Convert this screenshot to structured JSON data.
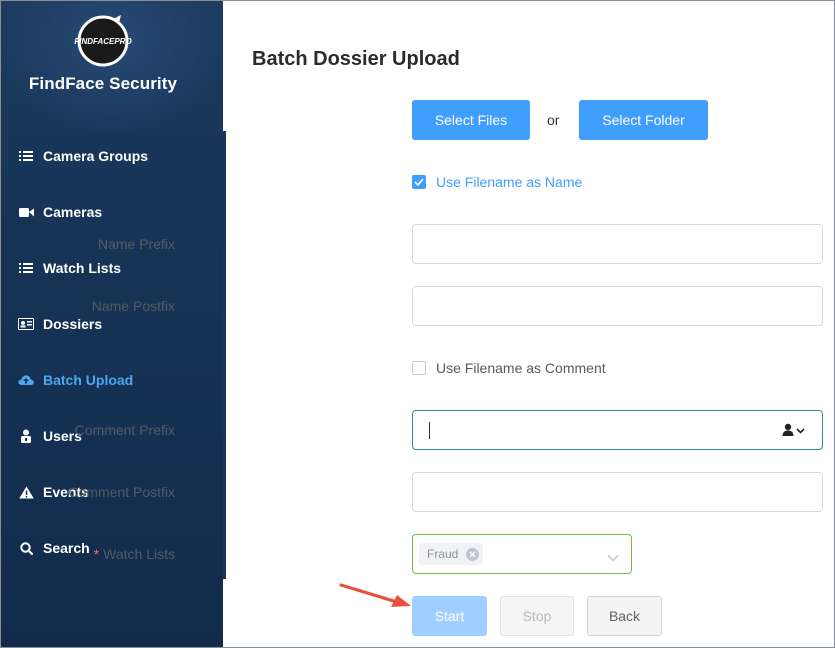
{
  "app": {
    "brand": "FindFace Security",
    "logo_text": "FINDFACEPRO"
  },
  "sidebar": {
    "items": [
      {
        "label": "Camera Groups",
        "icon": "list-icon",
        "active": false
      },
      {
        "label": "Cameras",
        "icon": "video-camera-icon",
        "active": false
      },
      {
        "label": "Watch Lists",
        "icon": "list-icon",
        "active": false
      },
      {
        "label": "Dossiers",
        "icon": "id-card-icon",
        "active": false
      },
      {
        "label": "Batch Upload",
        "icon": "cloud-upload-icon",
        "active": true
      },
      {
        "label": "Users",
        "icon": "user-lock-icon",
        "active": false
      },
      {
        "label": "Events",
        "icon": "warning-icon",
        "active": false
      },
      {
        "label": "Search",
        "icon": "search-icon",
        "active": false
      }
    ]
  },
  "main": {
    "title": "Batch Dossier Upload",
    "select_files": "Select Files",
    "or_text": "or",
    "select_folder": "Select Folder",
    "use_filename_as_name": {
      "label": "Use Filename as Name",
      "checked": true
    },
    "name_prefix": {
      "label": "Name Prefix",
      "value": ""
    },
    "name_postfix": {
      "label": "Name Postfix",
      "value": ""
    },
    "use_filename_as_comment": {
      "label": "Use Filename as Comment",
      "checked": false
    },
    "comment_prefix": {
      "label": "Comment Prefix",
      "value": ""
    },
    "comment_postfix": {
      "label": "Comment Postfix",
      "value": ""
    },
    "watch_lists": {
      "label": "Watch Lists",
      "required_mark": "*",
      "selected": [
        "Fraud"
      ]
    },
    "start": "Start",
    "stop": "Stop",
    "back": "Back"
  },
  "colors": {
    "primary": "#409eff",
    "sidebar_bg": "#163356",
    "active_nav": "#4aa8f0",
    "valid_border": "#67c23a",
    "annotation_arrow": "#e5533d"
  }
}
